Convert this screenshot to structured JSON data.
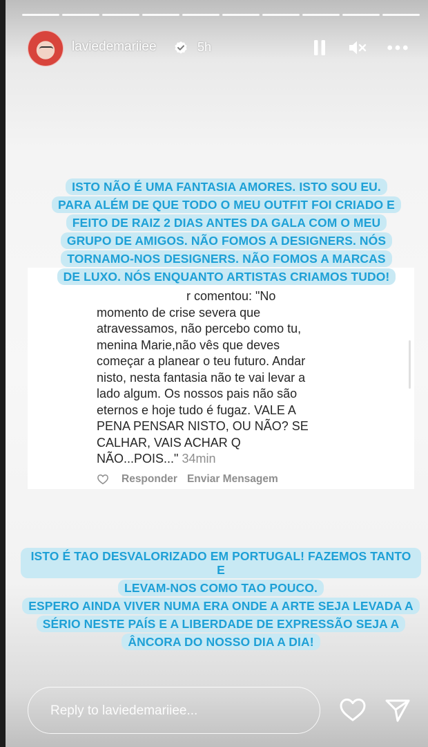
{
  "story": {
    "progress_segments": 10,
    "username": "laviedemariiee",
    "time_ago": "5h",
    "icons": [
      "verified-icon",
      "pause-icon",
      "mute-icon",
      "more-icon",
      "heart-icon",
      "send-icon"
    ]
  },
  "top_text": {
    "lines": [
      "ISTO NÃO É UMA FANTASIA AMORES. ISTO SOU EU.",
      "PARA ALÉM DE QUE TODO O MEU OUTFIT FOI CRIADO E",
      "FEITO DE RAIZ 2 DIAS ANTES DA GALA COM O MEU",
      "GRUPO DE AMIGOS. NÃO FOMOS A DESIGNERS. NÓS",
      "TORNAMO-NOS DESIGNERS. NÃO FOMOS A MARCAS",
      "DE LUXO. NÓS ENQUANTO ARTISTAS CRIAMOS TUDO!"
    ]
  },
  "comment": {
    "lines": [
      "r comentou: \"No",
      "momento de crise severa que",
      "atravessamos, não percebo como tu,",
      "menina Marie,não vês que deves",
      "começar a planear o teu futuro. Andar",
      "nisto, nesta fantasia não te vai levar a",
      "lado algum. Os nossos pais não são",
      "eternos e hoje tudo é fugaz. VALE  A",
      "PENA PENSAR NISTO, OU NÃO? SE",
      "CALHAR, VAIS ACHAR Q",
      "NÃO...POIS...\""
    ],
    "time_ago": "34min",
    "reply_label": "Responder",
    "send_message_label": "Enviar Mensagem"
  },
  "bottom_text": {
    "lines": [
      "ISTO É TAO DESVALORIZADO EM PORTUGAL! FAZEMOS TANTO E",
      "LEVAM-NOS COMO TAO POUCO.",
      "ESPERO AINDA VIVER NUMA ERA ONDE A ARTE SEJA LEVADA A",
      "SÉRIO NESTE PAÍS E A LIBERDADE DE EXPRESSÃO SEJA A",
      "ÂNCORA DO NOSSO DIA A DIA!"
    ]
  },
  "footer": {
    "reply_placeholder": "Reply to laviedemariiee..."
  },
  "colors": {
    "highlight_bg": "#c8e9f4",
    "highlight_text": "#1ea0d6",
    "comment_text": "#262626",
    "muted": "#8e8e8e"
  }
}
